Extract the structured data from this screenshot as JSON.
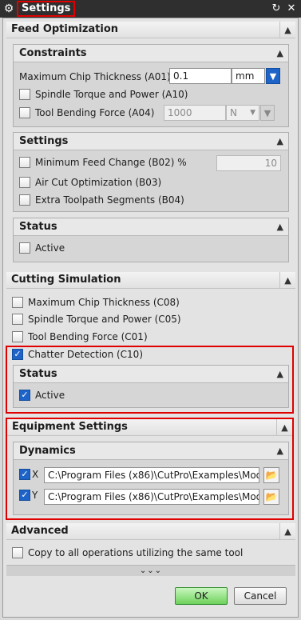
{
  "window": {
    "title": "Settings",
    "buttons": {
      "reset": "↻",
      "close": "✕"
    }
  },
  "feed_optimization": {
    "header": "Feed Optimization",
    "constraints": {
      "title": "Constraints",
      "max_chip_label": "Maximum Chip Thickness (A01)",
      "max_chip_value": "0.1",
      "max_chip_unit": "mm",
      "spindle_label": "Spindle Torque and Power (A10)",
      "tool_bending_label": "Tool Bending Force (A04)",
      "tool_bending_value": "1000",
      "tool_bending_unit": "N"
    },
    "settings": {
      "title": "Settings",
      "min_feed_label": "Minimum Feed Change (B02) %",
      "min_feed_value": "10",
      "air_cut_label": "Air Cut Optimization (B03)",
      "extra_toolpath_label": "Extra Toolpath Segments (B04)"
    },
    "status": {
      "title": "Status",
      "active_label": "Active"
    }
  },
  "cutting_simulation": {
    "header": "Cutting Simulation",
    "items": [
      {
        "label": "Maximum Chip Thickness (C08)",
        "checked": false
      },
      {
        "label": "Spindle Torque and Power (C05)",
        "checked": false
      },
      {
        "label": "Tool Bending Force (C01)",
        "checked": false
      },
      {
        "label": "Chatter Detection (C10)",
        "checked": true
      }
    ],
    "status": {
      "title": "Status",
      "active_label": "Active",
      "active_checked": true
    }
  },
  "equipment_settings": {
    "header": "Equipment Settings",
    "dynamics": {
      "title": "Dynamics",
      "x_label": "X",
      "x_path": "C:\\Program Files (x86)\\CutPro\\Examples\\Mod",
      "y_label": "Y",
      "y_path": "C:\\Program Files (x86)\\CutPro\\Examples\\Mod"
    }
  },
  "advanced": {
    "header": "Advanced",
    "copy_label": "Copy to all operations utilizing the same tool"
  },
  "more_glyph": "⌄⌄⌄",
  "footer": {
    "ok": "OK",
    "cancel": "Cancel"
  },
  "icons": {
    "gear": "gear-icon",
    "collapse": "chevron-up-icon",
    "folder": "folder-icon",
    "dropdown": "chevron-down-icon"
  },
  "colors": {
    "accent_red": "#e00000",
    "checkbox_blue": "#1e64c8",
    "ok_green": "#6ed25c"
  }
}
